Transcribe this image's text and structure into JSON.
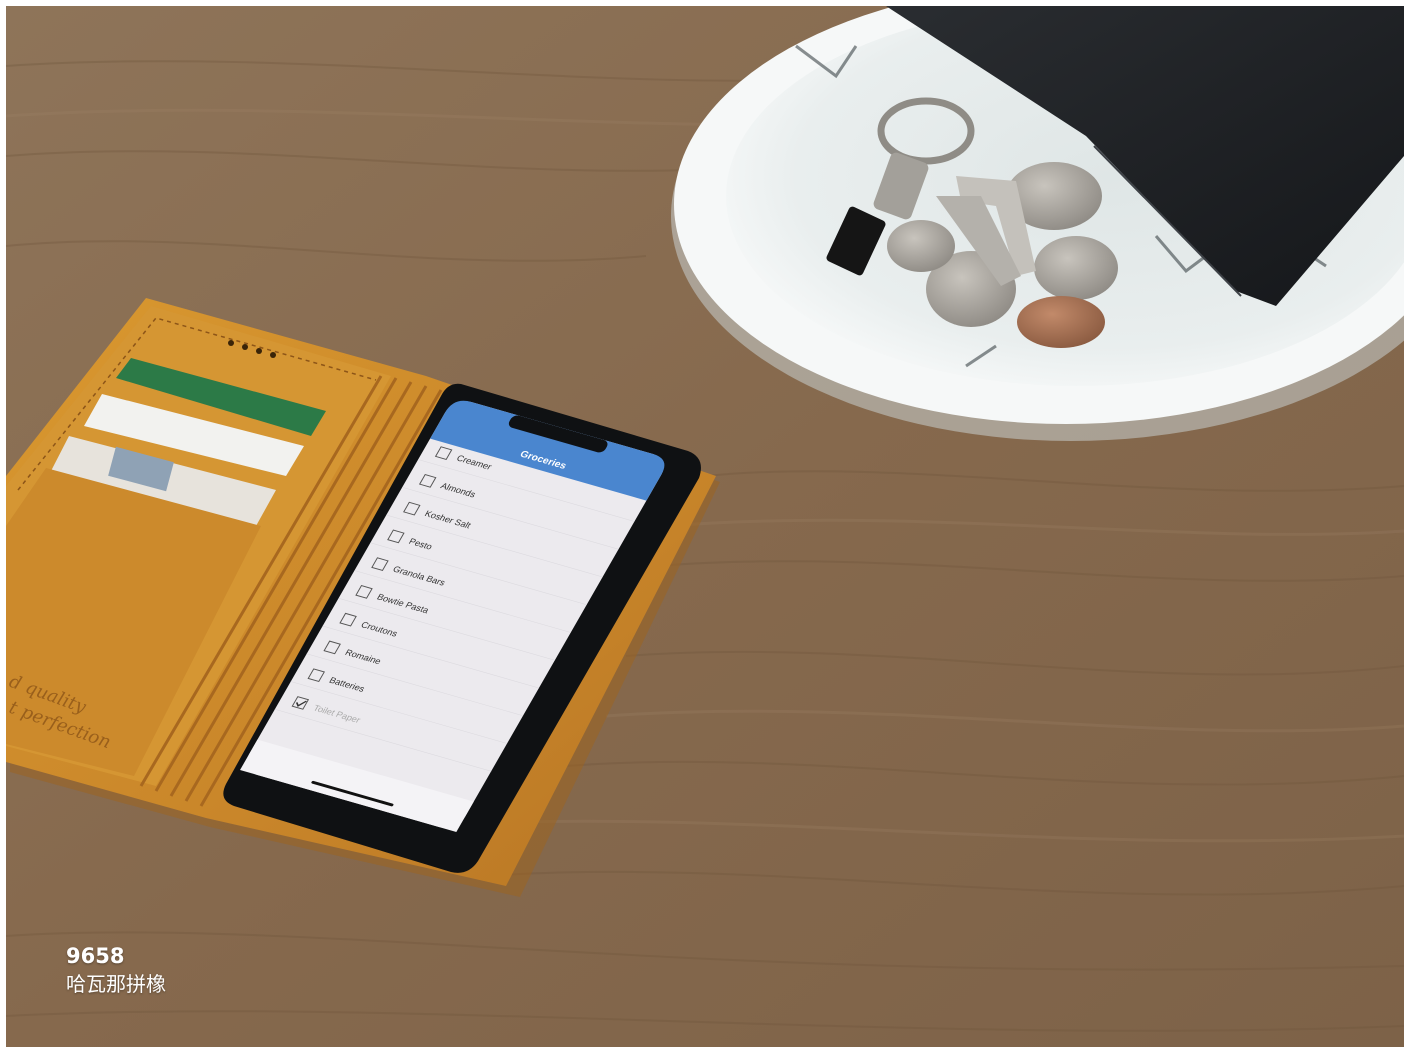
{
  "photo": {
    "subject": "phone-in-leather-wallet-case-on-wood-table",
    "colors": {
      "wood": "#8a7055",
      "leather": "#cf8f2e",
      "dish": "#eef2f2",
      "wallet": "#1c1e21",
      "screen_header": "#4a86cf"
    }
  },
  "phone_screen": {
    "header_title": "Groceries",
    "items": [
      {
        "label": "Creamer",
        "checked": false
      },
      {
        "label": "Almonds",
        "checked": false
      },
      {
        "label": "Kosher Salt",
        "checked": false
      },
      {
        "label": "Pesto",
        "checked": false
      },
      {
        "label": "Granola Bars",
        "checked": false
      },
      {
        "label": "Bowtie Pasta",
        "checked": false
      },
      {
        "label": "Croutons",
        "checked": false
      },
      {
        "label": "Romaine",
        "checked": false
      },
      {
        "label": "Batteries",
        "checked": false
      },
      {
        "label": "Toilet Paper",
        "checked": true
      }
    ]
  },
  "case_emboss": [
    "d quality",
    "t perfection"
  ],
  "caption": {
    "code": "9658",
    "name": "哈瓦那拼橡"
  }
}
